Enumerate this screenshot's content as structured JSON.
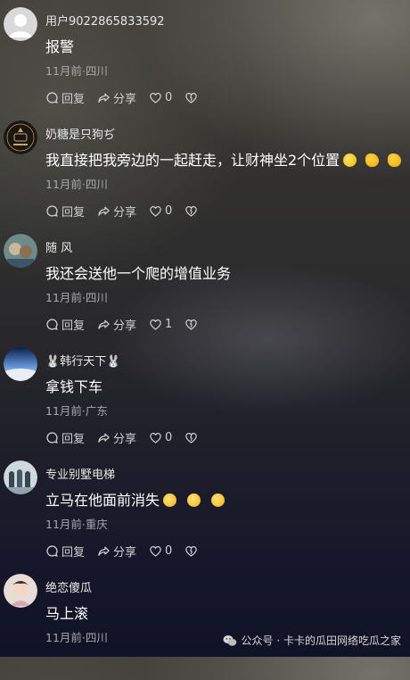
{
  "comments": [
    {
      "username": "用户9022865833592",
      "content": "报警",
      "meta": "11月前·四川",
      "reply_label": "回复",
      "share_label": "分享",
      "likes": "0"
    },
    {
      "username": "奶糖是只狗ぢ",
      "content": "我直接把我旁边的一起赶走，让财神坐2个位置",
      "meta": "11月前·四川",
      "reply_label": "回复",
      "share_label": "分享",
      "likes": "0"
    },
    {
      "username": "随 风",
      "content": "我还会送他一个爬的增值业务",
      "meta": "11月前·四川",
      "reply_label": "回复",
      "share_label": "分享",
      "likes": "1"
    },
    {
      "username": "韩行天下",
      "content": "拿钱下车",
      "meta": "11月前·广东",
      "reply_label": "回复",
      "share_label": "分享",
      "likes": "0"
    },
    {
      "username": "专业别墅电梯",
      "content": "立马在他面前消失",
      "meta": "11月前·重庆",
      "reply_label": "回复",
      "share_label": "分享",
      "likes": "0"
    },
    {
      "username": "绝恋傻瓜",
      "content": "马上滚",
      "meta": "11月前·四川"
    }
  ],
  "watermark": {
    "text": "公众号 · 卡卡的瓜田网络吃瓜之家",
    "icon": "wechat-icon"
  },
  "colors": {
    "text_primary": "#ffffff",
    "text_secondary": "#a8a8a8",
    "action_text": "#cfcfcf"
  }
}
